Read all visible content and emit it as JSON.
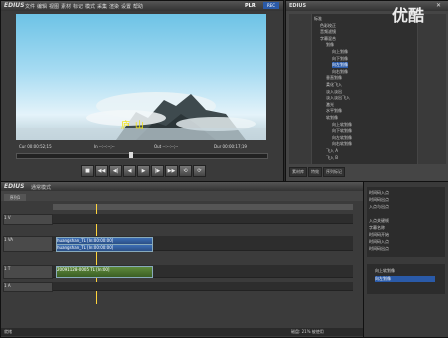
{
  "player": {
    "logo": "EDIUS",
    "menus": [
      "文件",
      "编辑",
      "视图",
      "素材",
      "标记",
      "模式",
      "采集",
      "渲染",
      "设置",
      "帮助"
    ],
    "plr": "PLR",
    "rec": "REC",
    "caption": "庐 山",
    "timecodes": {
      "cur": "Cur 00:00:52;15",
      "in": "In --:--:--;--",
      "out": "Out --:--:--;--",
      "dur": "Dur 00:00:17;19"
    },
    "transport": [
      "■",
      "◀◀",
      "◀|",
      "◀",
      "▶",
      "|▶",
      "▶▶",
      "⟲",
      "⟳"
    ]
  },
  "effects": {
    "title": "EDIUS",
    "tree": [
      {
        "label": "标准",
        "indent": 0
      },
      {
        "label": "色彩校正",
        "indent": 1
      },
      {
        "label": "音频滤镜",
        "indent": 1
      },
      {
        "label": "字幕混合",
        "indent": 1
      },
      {
        "label": "划像",
        "indent": 2
      },
      {
        "label": "向上划像",
        "indent": 3
      },
      {
        "label": "向下划像",
        "indent": 3
      },
      {
        "label": "向左划像",
        "indent": 3,
        "selected": true
      },
      {
        "label": "向右划像",
        "indent": 3
      },
      {
        "label": "垂直划像",
        "indent": 2
      },
      {
        "label": "柔化飞入",
        "indent": 2
      },
      {
        "label": "淡入淡出",
        "indent": 2
      },
      {
        "label": "淡入淡出飞入",
        "indent": 2
      },
      {
        "label": "激光",
        "indent": 2
      },
      {
        "label": "水平划像",
        "indent": 2
      },
      {
        "label": "软划像",
        "indent": 2
      },
      {
        "label": "向上软划像",
        "indent": 3
      },
      {
        "label": "向下软划像",
        "indent": 3
      },
      {
        "label": "向左软划像",
        "indent": 3
      },
      {
        "label": "向右软划像",
        "indent": 3
      },
      {
        "label": "飞入 A",
        "indent": 2
      },
      {
        "label": "飞入 B",
        "indent": 2
      }
    ],
    "tabs": [
      "素材库",
      "特效",
      "序列标记"
    ]
  },
  "timeline": {
    "logo": "EDIUS",
    "mode": "通常模式",
    "sequence": "序列1",
    "tracks": [
      {
        "name": "1 V",
        "type": "video"
      },
      {
        "name": "1 VA",
        "type": "va"
      },
      {
        "name": "1 T",
        "type": "title"
      },
      {
        "name": "1 A",
        "type": "audio"
      }
    ],
    "clips": [
      {
        "label": "huangshan_TL [In:00:00:00]"
      },
      {
        "label": "huangshan_TL [In:00:00:00]"
      },
      {
        "label": "20091128-0005 TL [In:00]"
      }
    ],
    "status": "就绪",
    "disk": "磁盘: 21% 被使用"
  },
  "info": {
    "rows": [
      "时间码入点",
      "时间码出点",
      "入点与出点",
      "",
      "入点关键帧",
      "字幕名称",
      "时间码开始",
      "时间码入点",
      "时间码出点"
    ],
    "layers": [
      {
        "label": "向上软划像"
      },
      {
        "label": "向左划像",
        "selected": true
      }
    ]
  },
  "watermark": "优酷"
}
